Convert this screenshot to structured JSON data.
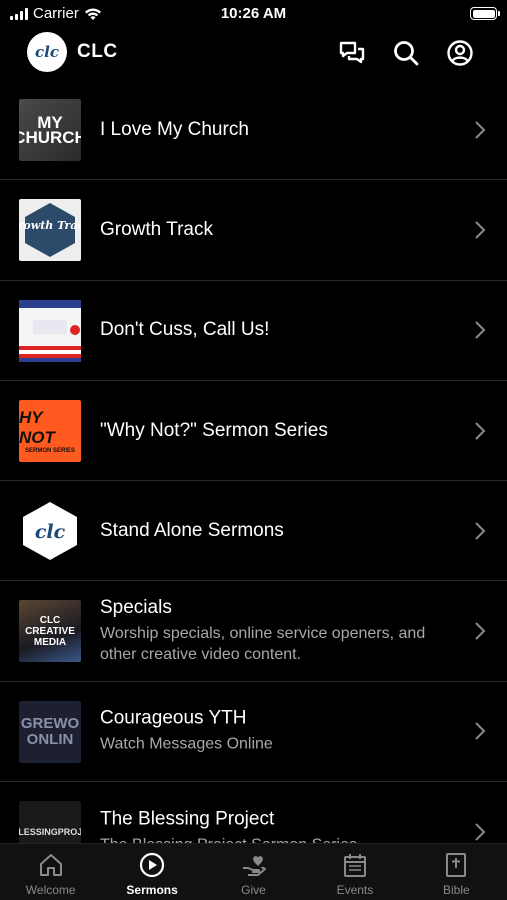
{
  "status_bar": {
    "carrier": "Carrier",
    "time": "10:26 AM"
  },
  "header": {
    "logo_text": "clc",
    "title": "CLC"
  },
  "thumbs": {
    "t1_top": "MY",
    "t1_bottom": "CHURCH",
    "t2": "Growth Track",
    "t4_top": "HY NOT",
    "t4_bottom": "SERMON SERIES",
    "t5": "clc",
    "t6": "CLC CREATIVE MEDIA",
    "t7_top": "GREWO",
    "t7_bottom": "ONLIN",
    "t8": "BLESSINGPROJE"
  },
  "list": [
    {
      "title": "I Love My Church",
      "subtitle": ""
    },
    {
      "title": "Growth Track",
      "subtitle": ""
    },
    {
      "title": "Don't Cuss, Call Us!",
      "subtitle": ""
    },
    {
      "title": "\"Why Not?\" Sermon Series",
      "subtitle": ""
    },
    {
      "title": "Stand Alone Sermons",
      "subtitle": ""
    },
    {
      "title": "Specials",
      "subtitle": "Worship specials, online service openers, and other creative video content."
    },
    {
      "title": "Courageous YTH",
      "subtitle": "Watch Messages Online"
    },
    {
      "title": "The Blessing Project",
      "subtitle": "The Blessing Project Sermon Series"
    }
  ],
  "tabs": [
    {
      "label": "Welcome",
      "icon": "home-icon",
      "active": false
    },
    {
      "label": "Sermons",
      "icon": "play-circle-icon",
      "active": true
    },
    {
      "label": "Give",
      "icon": "give-heart-icon",
      "active": false
    },
    {
      "label": "Events",
      "icon": "calendar-icon",
      "active": false
    },
    {
      "label": "Bible",
      "icon": "bible-icon",
      "active": false
    }
  ],
  "colors": {
    "background": "#000000",
    "accent": "#ffffff",
    "inactive_tab": "#8a8a8a",
    "subtitle": "#a8a8a8"
  }
}
